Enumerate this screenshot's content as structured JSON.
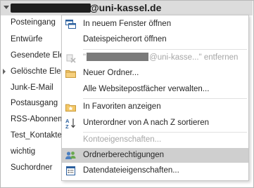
{
  "account": {
    "domain": "@uni-kassel.de"
  },
  "folders": [
    {
      "label": "Posteingang",
      "has_children": false
    },
    {
      "label": "Entwürfe",
      "has_children": false
    },
    {
      "label": "Gesendete Ele",
      "has_children": false
    },
    {
      "label": "Gelöschte Ele",
      "has_children": true
    },
    {
      "label": "Junk-E-Mail",
      "has_children": false
    },
    {
      "label": "Postausgang",
      "has_children": false
    },
    {
      "label": "RSS-Abonnem",
      "has_children": false
    },
    {
      "label": "Test_Kontakte",
      "has_children": false
    },
    {
      "label": "wichtig",
      "has_children": false
    },
    {
      "label": "Suchordner",
      "has_children": false
    }
  ],
  "menu": {
    "open_new_window": "In neuem Fenster öffnen",
    "open_file_location": "Dateispeicherort öffnen",
    "remove_prefix": "\"",
    "remove_domain": "@uni-kasse...\"",
    "remove_verb": "entfernen",
    "new_folder": "Neuer Ordner...",
    "manage_public_folders": "Alle Websitepostfächer verwalten...",
    "show_in_favorites": "In Favoriten anzeigen",
    "sort_subfolders": "Unterordner von A nach Z sortieren",
    "account_properties": "Kontoeigenschaften...",
    "folder_permissions": "Ordnerberechtigungen",
    "data_file_properties": "Datendateieigenschaften..."
  },
  "colors": {
    "folder_yellow": "#e8b84a",
    "favorite_star": "#f0b400",
    "highlight": "#cfcfcf",
    "disabled_text": "#a6a6a6"
  }
}
